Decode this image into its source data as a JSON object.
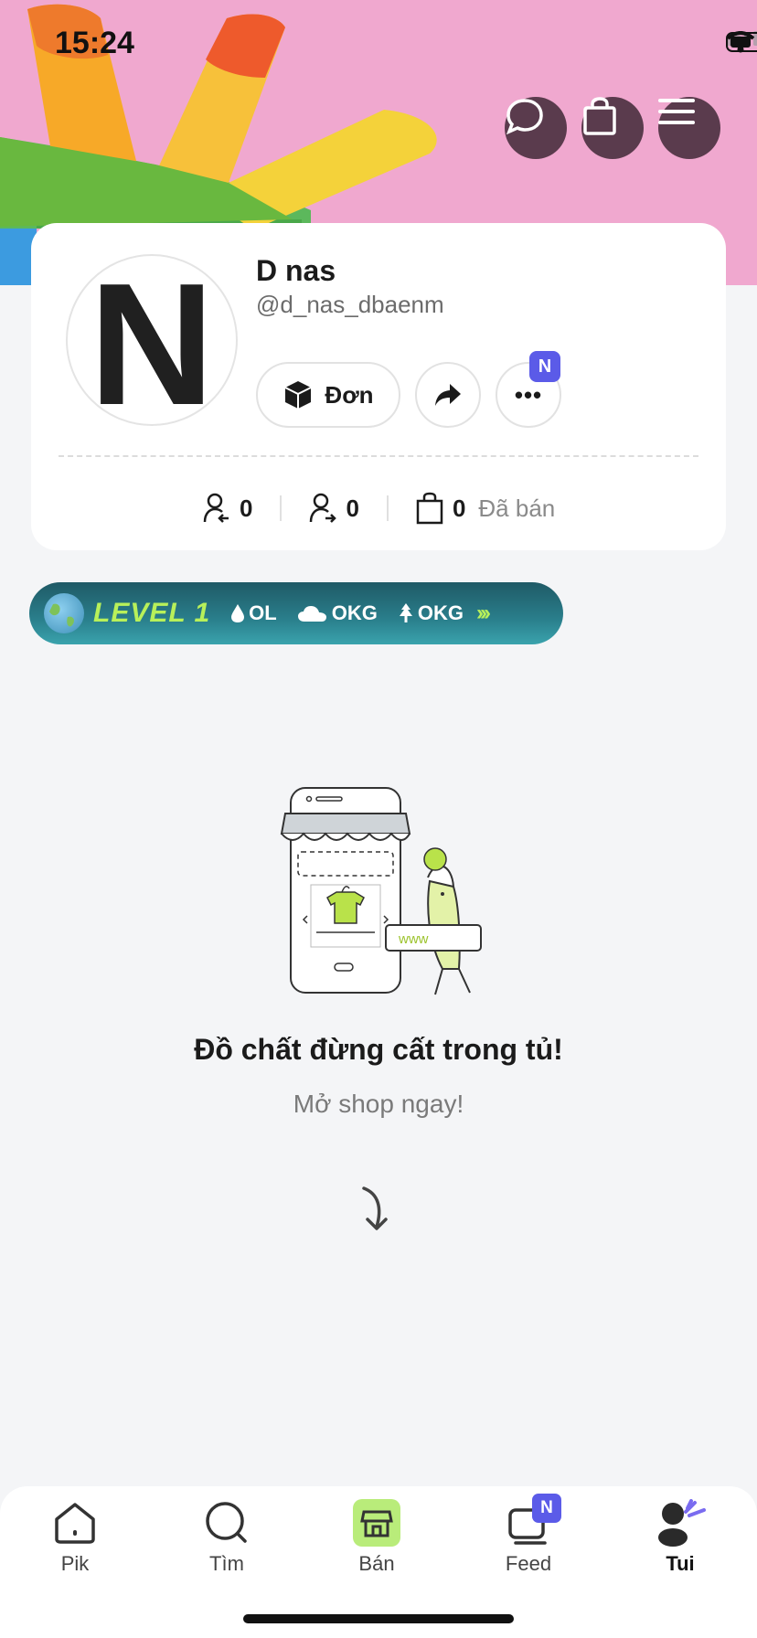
{
  "status_bar": {
    "time": "15:24"
  },
  "header": {
    "buttons": [
      {
        "name": "chat-button",
        "icon": "chat-bubble-icon"
      },
      {
        "name": "bag-button",
        "icon": "shopping-bag-icon"
      },
      {
        "name": "menu-button",
        "icon": "hamburger-menu-icon"
      }
    ]
  },
  "profile": {
    "avatar_letter": "N",
    "name": "D nas",
    "handle": "@d_nas_dbaenm",
    "order_button": "Đơn",
    "more_button": "•••",
    "more_badge": "N"
  },
  "stats": {
    "followers": "0",
    "following": "0",
    "sold_count": "0",
    "sold_label": "Đã bán"
  },
  "level": {
    "label": "LEVEL 1",
    "water": "OL",
    "cloud": "OKG",
    "tree": "OKG"
  },
  "empty_state": {
    "title": "Đồ chất đừng cất trong tủ!",
    "subtitle": "Mở shop ngay!",
    "illustration_text": "www"
  },
  "bottom_nav": {
    "items": [
      {
        "label": "Pik",
        "icon": "home-icon"
      },
      {
        "label": "Tìm",
        "icon": "search-icon"
      },
      {
        "label": "Bán",
        "icon": "shop-icon"
      },
      {
        "label": "Feed",
        "icon": "feed-icon",
        "badge": "N"
      },
      {
        "label": "Tui",
        "icon": "profile-icon",
        "active": true
      }
    ]
  },
  "colors": {
    "banner_pink": "#f0a8cf",
    "accent_purple": "#5b5be8",
    "level_green": "#b8f05a",
    "header_button": "#5a3b4d"
  }
}
